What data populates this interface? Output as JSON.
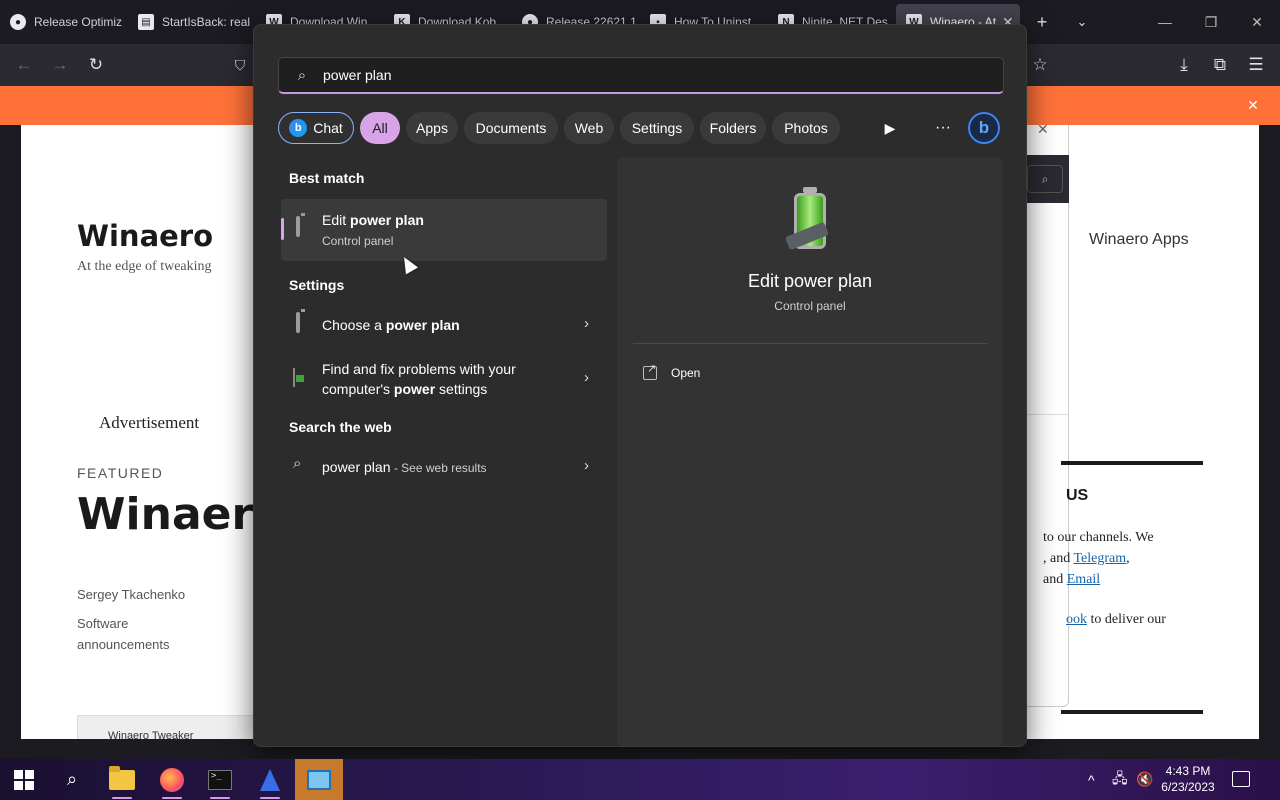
{
  "browser": {
    "tabs": [
      {
        "label": "Release Optimiz",
        "icon": "github-icon"
      },
      {
        "label": "StartIsBack: real",
        "icon": "startisback-icon"
      },
      {
        "label": "Download Win",
        "icon": "winaero-icon"
      },
      {
        "label": "Download Kob",
        "icon": "kobo-icon"
      },
      {
        "label": "Release 22621.1",
        "icon": "github-icon"
      },
      {
        "label": "How To Uninst",
        "icon": "page-icon"
      },
      {
        "label": "Ninite .NET Des",
        "icon": "ninite-icon"
      },
      {
        "label": "Winaero - At",
        "icon": "winaero-icon"
      }
    ]
  },
  "webpage": {
    "site_title": "Winaero",
    "tagline": "At the edge of tweaking",
    "apps_link": "Winaero Apps",
    "advertisement": "Advertisement",
    "featured_label": "FEATURED",
    "featured_title": "Winaero",
    "author": "Sergey Tkachenko",
    "category": "Software announcements",
    "thumb_label": "Winaero Tweaker",
    "right_heading": "US",
    "right_text_1": "to our channels. We",
    "right_text_2": ", and",
    "telegram": "Telegram",
    "right_text_3": ",",
    "right_text_4": "and",
    "email": "Email",
    "right_link_fragment": "ook",
    "right_text_5": "to deliver our"
  },
  "search": {
    "query": "power plan",
    "chips": [
      "Chat",
      "All",
      "Apps",
      "Documents",
      "Web",
      "Settings",
      "Folders",
      "Photos"
    ],
    "selected_chip": "All",
    "sections": {
      "best_match": "Best match",
      "settings": "Settings",
      "search_web": "Search the web"
    },
    "best": {
      "title_pre": "Edit ",
      "title_bold": "power plan",
      "subtitle": "Control panel"
    },
    "settings_items": [
      {
        "pre": "Choose a ",
        "bold": "power plan",
        "post": ""
      },
      {
        "line1": "Find and fix problems with your",
        "pre": "computer's ",
        "bold": "power",
        "post": " settings"
      }
    ],
    "web": {
      "query": "power plan",
      "suffix": " - See web results"
    },
    "preview": {
      "title": "Edit power plan",
      "subtitle": "Control panel",
      "action_open": "Open"
    }
  },
  "taskbar": {
    "time": "4:43 PM",
    "date": "6/23/2023"
  }
}
